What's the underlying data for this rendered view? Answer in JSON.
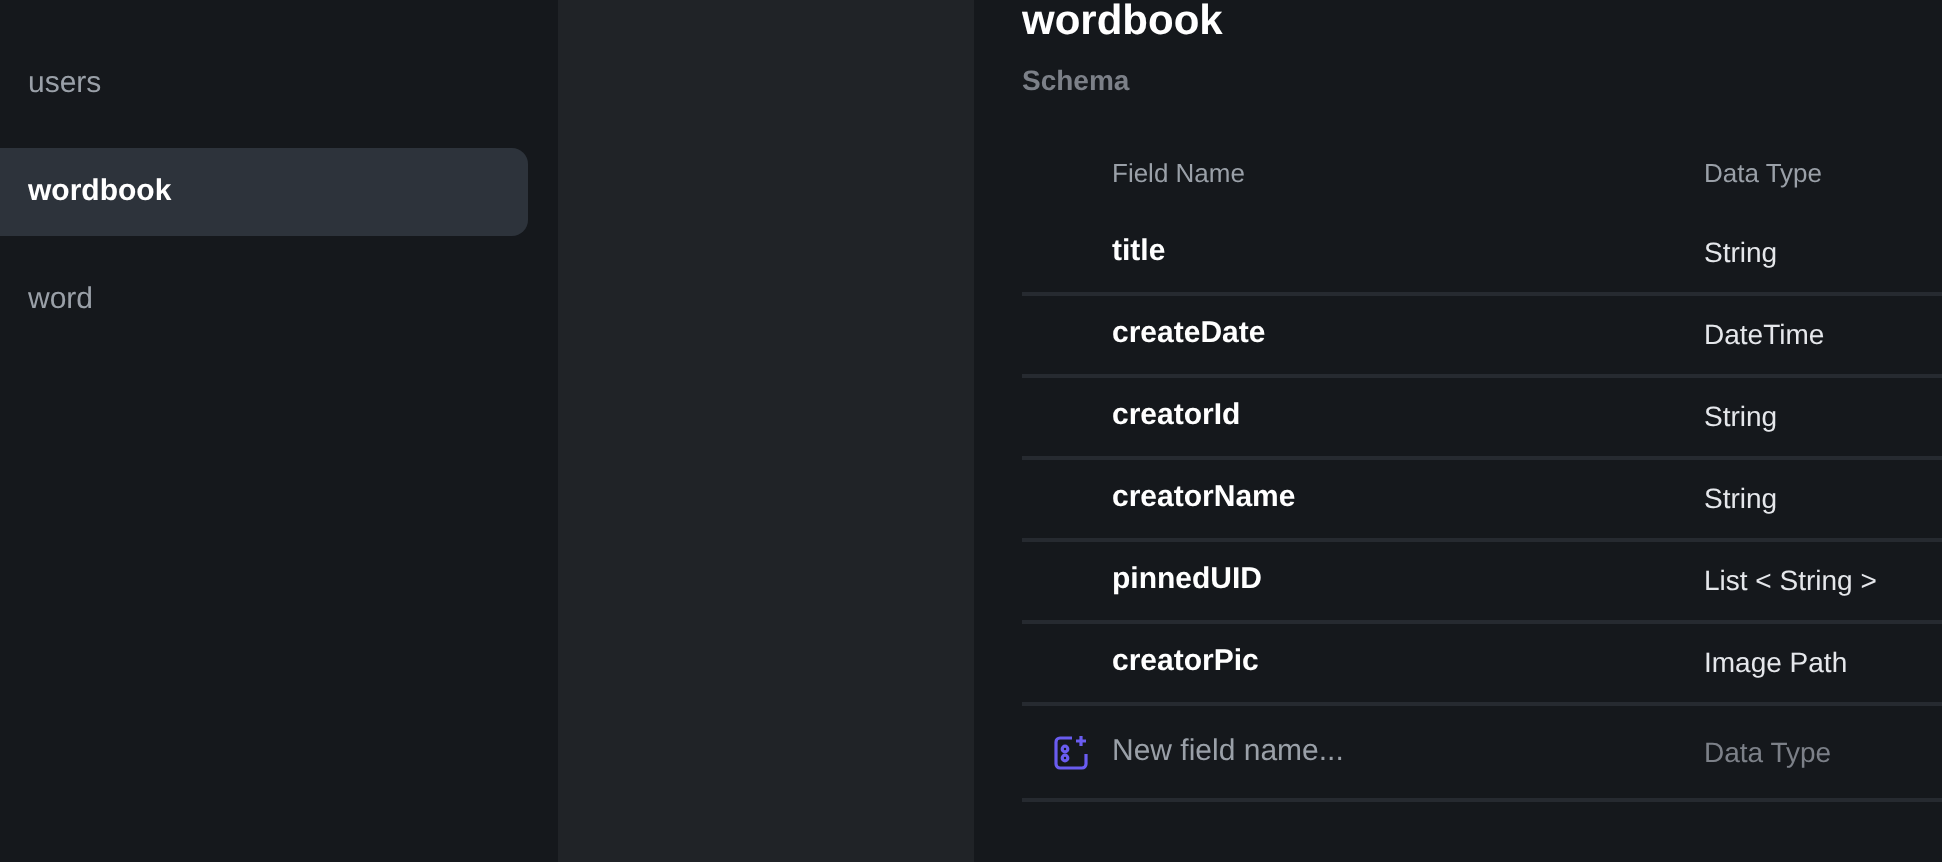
{
  "sidebar": {
    "items": [
      {
        "label": "users",
        "selected": false
      },
      {
        "label": "wordbook",
        "selected": true
      },
      {
        "label": "word",
        "selected": false
      }
    ]
  },
  "collection": {
    "title": "wordbook",
    "section": "Schema"
  },
  "table": {
    "columns": [
      "Field Name",
      "Data Type"
    ],
    "rows": [
      {
        "name": "title",
        "type": "String"
      },
      {
        "name": "createDate",
        "type": "DateTime"
      },
      {
        "name": "creatorId",
        "type": "String"
      },
      {
        "name": "creatorName",
        "type": "String"
      },
      {
        "name": "pinnedUID",
        "type": "List < String >"
      },
      {
        "name": "creatorPic",
        "type": "Image Path"
      }
    ],
    "new_field": {
      "placeholder": "New field name...",
      "type_placeholder": "Data Type"
    }
  }
}
